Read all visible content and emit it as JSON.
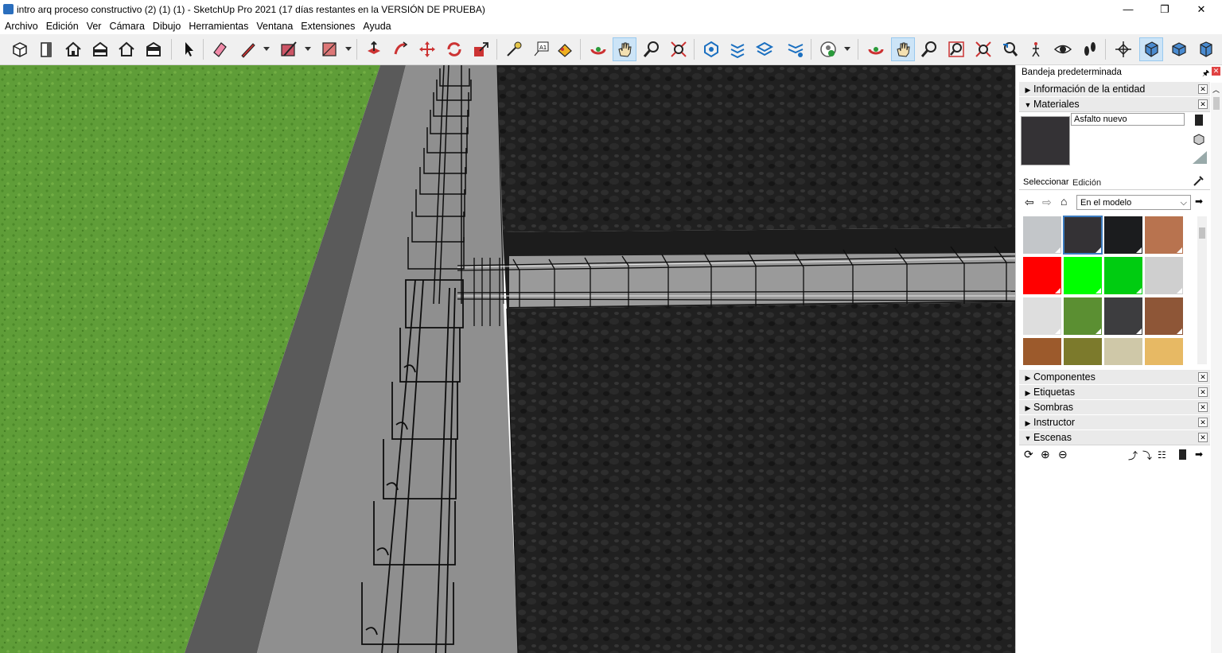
{
  "window": {
    "title": "intro arq proceso constructivo (2) (1) (1) - SketchUp Pro 2021 (17 días restantes en la VERSIÓN DE PRUEBA)",
    "minimize": "—",
    "maximize": "❐",
    "close": "✕"
  },
  "menu": [
    "Archivo",
    "Edición",
    "Ver",
    "Cámara",
    "Dibujo",
    "Herramientas",
    "Ventana",
    "Extensiones",
    "Ayuda"
  ],
  "toolbar": {
    "active_tools": [
      "pan-tool",
      "pan-tool-2",
      "perspective-view"
    ]
  },
  "tray": {
    "title": "Bandeja predeterminada",
    "panels": {
      "entity_info": "Información de la entidad",
      "materials": "Materiales",
      "components": "Componentes",
      "tags": "Etiquetas",
      "shadows": "Sombras",
      "instructor": "Instructor",
      "scenes": "Escenas"
    },
    "materials": {
      "current_name": "Asfalto nuevo",
      "tab_select": "Seleccionar",
      "tab_edit": "Edición",
      "library": "En el modelo",
      "swatch_colors": [
        "#c3c6c9",
        "#343235",
        "#1b1c1e",
        "#b8734f",
        "#ff0000",
        "#00ff00",
        "#00cc11",
        "#cfcfcf",
        "#dedede",
        "#5b8f32",
        "#3d3d3f",
        "#8e5637",
        "#9c5a2c",
        "#7c7a2c",
        "#cfc8a8",
        "#e7b964"
      ]
    }
  },
  "colors": {
    "grass": "#5a9a34",
    "concrete": "#8f8f8f",
    "asphalt": "#1f1f1f",
    "accent": "#3b7bbf"
  }
}
